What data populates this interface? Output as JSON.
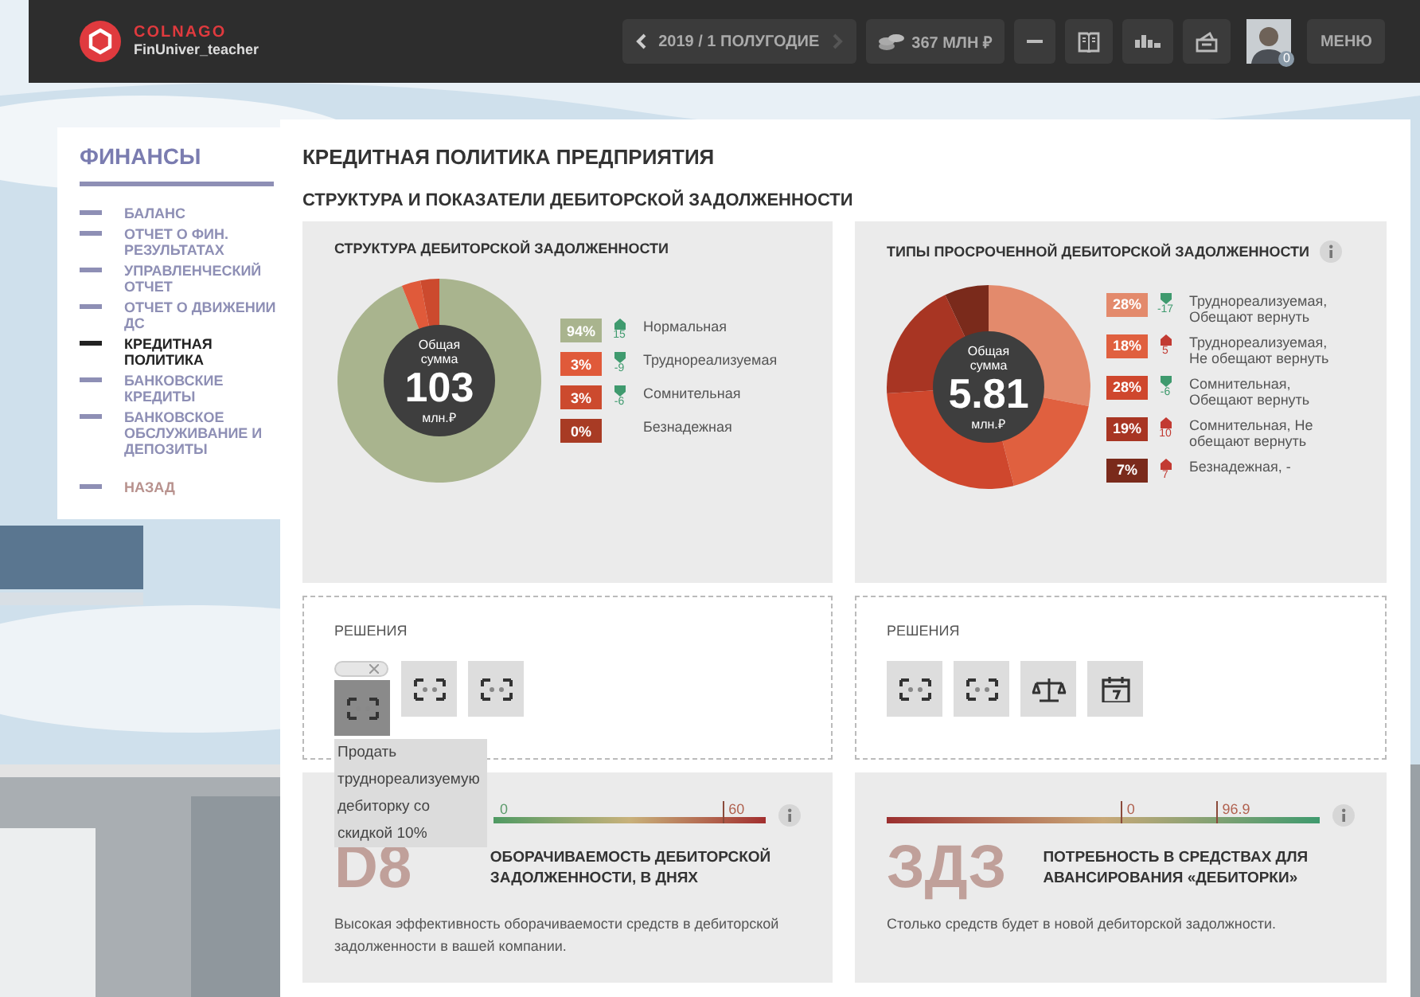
{
  "topbar": {
    "brand": "COLNAGO",
    "user": "FinUniver_teacher",
    "period": "2019 / 1 ПОЛУГОДИЕ",
    "prev_disabled": false,
    "next_disabled": true,
    "balance": "367 МЛН ₽",
    "avatar_badge": "0",
    "menu": "МЕНЮ"
  },
  "sidebar": {
    "title": "ФИНАНСЫ",
    "items": [
      {
        "label": "БАЛАНС",
        "selected": false
      },
      {
        "label": "ОТЧЕТ О ФИН. РЕЗУЛЬТАТАХ",
        "selected": false
      },
      {
        "label": "УПРАВЛЕНЧЕСКИЙ ОТЧЕТ",
        "selected": false
      },
      {
        "label": "ОТЧЕТ О ДВИЖЕНИИ ДС",
        "selected": false
      },
      {
        "label": "КРЕДИТНАЯ ПОЛИТИКА",
        "selected": true
      },
      {
        "label": "БАНКОВСКИЕ КРЕДИТЫ",
        "selected": false
      },
      {
        "label": "БАНКОВСКОЕ ОБСЛУЖИВАНИЕ И ДЕПОЗИТЫ",
        "selected": false
      }
    ],
    "back": "НАЗАД"
  },
  "page_title": "КРЕДИТНАЯ ПОЛИТИКА ПРЕДПРИЯТИЯ",
  "section_title": "СТРУКТУРА И ПОКАЗАТЕЛИ ДЕБИТОРСКОЙ ЗАДОЛЖЕННОСТИ",
  "charts": [
    {
      "title": "СТРУКТУРА ДЕБИТОРСКОЙ ЗАДОЛЖЕННОСТИ",
      "info": false,
      "center": {
        "caption": "Общая сумма",
        "value": "103",
        "unit": "млн.₽"
      },
      "chart_data": {
        "type": "donut",
        "values": [
          94,
          3,
          3,
          0
        ]
      },
      "legend": [
        {
          "share": "94%",
          "color": "#a9b48e",
          "trend": {
            "kind": "up",
            "value": "15",
            "color": "#3f9a6e"
          },
          "label": "Нормальная"
        },
        {
          "share": "3%",
          "color": "#e05a3a",
          "trend": {
            "kind": "down",
            "value": "-9",
            "color": "#3f9a6e"
          },
          "label": "Труднореализуемая"
        },
        {
          "share": "3%",
          "color": "#cc4a2e",
          "trend": {
            "kind": "down",
            "value": "-6",
            "color": "#3f9a6e"
          },
          "label": "Сомнительная"
        },
        {
          "share": "0%",
          "color": "#a83b24",
          "label": "Безнадежная"
        }
      ]
    },
    {
      "title": "ТИПЫ ПРОСРОЧЕННОЙ ДЕБИТОРСКОЙ ЗАДОЛЖЕННОСТИ",
      "info": true,
      "center": {
        "caption": "Общая сумма",
        "value": "5.81",
        "unit": "млн.₽"
      },
      "chart_data": {
        "type": "donut",
        "values": [
          28,
          18,
          28,
          19,
          7
        ]
      },
      "legend": [
        {
          "share": "28%",
          "color": "#e38a6c",
          "trend": {
            "kind": "down",
            "value": "-17",
            "color": "#3f9a6e"
          },
          "label": "Труднореализуемая, Обещают вернуть"
        },
        {
          "share": "18%",
          "color": "#e0603f",
          "trend": {
            "kind": "up",
            "value": "5",
            "color": "#c23a32"
          },
          "label": "Труднореализуемая, Не обещают вернуть"
        },
        {
          "share": "28%",
          "color": "#cf472d",
          "trend": {
            "kind": "down",
            "value": "-6",
            "color": "#3f9a6e"
          },
          "label": "Сомнительная, Обещают вернуть"
        },
        {
          "share": "19%",
          "color": "#a83523",
          "trend": {
            "kind": "up",
            "value": "10",
            "color": "#c23a32"
          },
          "label": "Сомнительная, Не обещают вернуть"
        },
        {
          "share": "7%",
          "color": "#7a2a1b",
          "trend": {
            "kind": "up",
            "value": "7",
            "color": "#c23a32"
          },
          "label": "Безнадежная, -"
        }
      ]
    }
  ],
  "decisions": [
    {
      "title": "РЕШЕНИЯ",
      "items": [
        {
          "kind": "discount",
          "selected": true,
          "toggle_on": false,
          "tooltip": "Продать труднореализуемую дебиторку со скидкой 10%"
        },
        {
          "kind": "discount",
          "selected": false
        },
        {
          "kind": "discount",
          "selected": false
        }
      ]
    },
    {
      "title": "РЕШЕНИЯ",
      "items": [
        {
          "kind": "discount",
          "selected": false
        },
        {
          "kind": "discount",
          "selected": false
        },
        {
          "kind": "scales",
          "selected": false
        },
        {
          "kind": "calendar",
          "selected": false
        }
      ]
    }
  ],
  "indicators": [
    {
      "kind": "falling",
      "markers": [
        {
          "label": "0",
          "level": 0
        },
        {
          "label": "60",
          "level": 0.84
        }
      ],
      "code": "D8",
      "title": "ОБОРАЧИВАЕМОСТЬ ДЕБИТОРСКОЙ ЗАДОЛЖЕННОСТИ, В ДНЯХ",
      "note": "Высокая эффективность оборачиваемости средств в дебиторской задолженности в вашей компании."
    },
    {
      "kind": "rising",
      "markers": [
        {
          "label": "0",
          "level": 0.54
        },
        {
          "label": "96.9",
          "level": 0.76
        }
      ],
      "code": "ЗДЗ",
      "title": "ПОТРЕБНОСТЬ В СРЕДСТВАХ ДЛЯ АВАНСИРОВАНИЯ «ДЕБИТОРКИ»",
      "note": "Столько средств будет в новой дебиторской задолжности."
    }
  ]
}
